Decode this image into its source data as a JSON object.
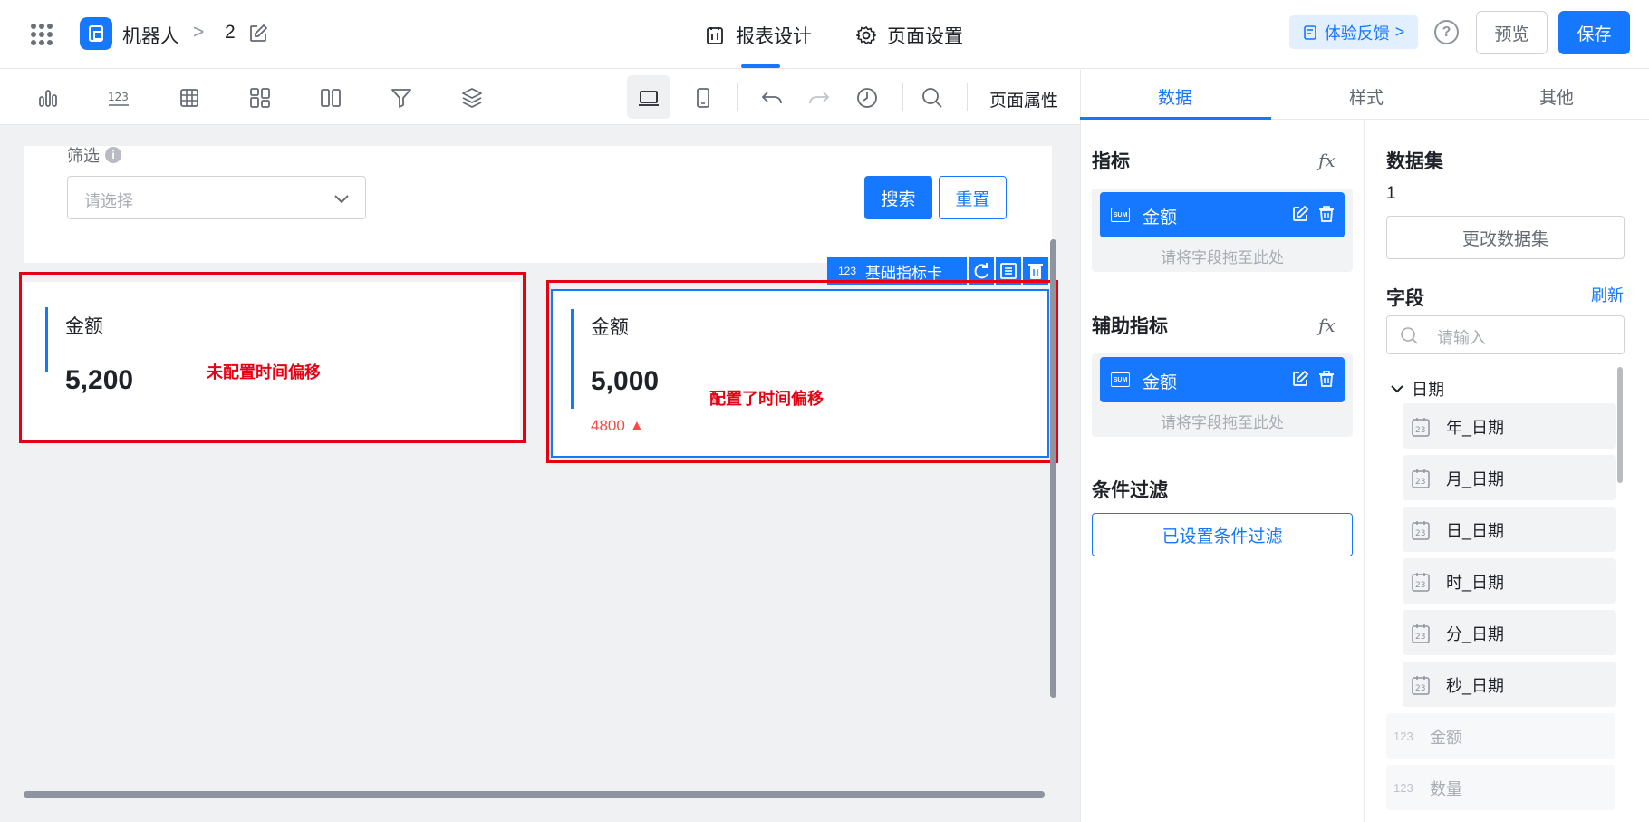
{
  "header": {
    "app_name": "机器人",
    "separator": ">",
    "page_name": "2",
    "tabs": [
      {
        "label": "报表设计",
        "icon": "report-design-icon"
      },
      {
        "label": "页面设置",
        "icon": "gear-icon"
      }
    ],
    "feedback_label": "体验反馈",
    "feedback_chevron": ">",
    "help_label": "?",
    "preview_label": "预览",
    "save_label": "保存"
  },
  "toolbar": {
    "icons": [
      "bar-chart-icon",
      "number-card-icon",
      "table-icon",
      "dashboard-grid-icon",
      "columns-icon",
      "filter-icon",
      "layers-icon",
      "desktop-view-icon",
      "mobile-view-icon",
      "undo-icon",
      "redo-icon",
      "history-icon",
      "search-icon"
    ],
    "page_props_label": "页面属性"
  },
  "canvas": {
    "filter": {
      "label": "筛选",
      "info": "i",
      "placeholder": "请选择",
      "search_label": "搜索",
      "reset_label": "重置"
    },
    "component_toolbar": {
      "badge": "123",
      "label": "基础指标卡"
    },
    "cards": [
      {
        "title": "金额",
        "value": "5,200",
        "note": "未配置时间偏移"
      },
      {
        "title": "金额",
        "value": "5,000",
        "compare": "4800 ▲",
        "note": "配置了时间偏移"
      }
    ]
  },
  "panel": {
    "tabs": [
      "数据",
      "样式",
      "其他"
    ],
    "active_tab": "数据",
    "metrics": {
      "title": "指标",
      "fx": "fx",
      "field": "金额",
      "sum_badge": "SUM",
      "drop_hint": "请将字段拖至此处"
    },
    "aux_metrics": {
      "title": "辅助指标",
      "fx": "fx",
      "field": "金额",
      "sum_badge": "SUM",
      "drop_hint": "请将字段拖至此处"
    },
    "condition": {
      "title": "条件过滤",
      "button_label": "已设置条件过滤"
    },
    "dataset": {
      "title": "数据集",
      "name": "1",
      "change_label": "更改数据集"
    },
    "fields": {
      "title": "字段",
      "refresh_label": "刷新",
      "search_placeholder": "请输入",
      "group_label": "日期",
      "date_items": [
        "年_日期",
        "月_日期",
        "日_日期",
        "时_日期",
        "分_日期",
        "秒_日期"
      ],
      "number_badge": "123",
      "number_items": [
        "金额",
        "数量"
      ]
    }
  },
  "colors": {
    "accent": "#1677ff",
    "annotation": "#e60012",
    "rise": "#f54a45"
  }
}
